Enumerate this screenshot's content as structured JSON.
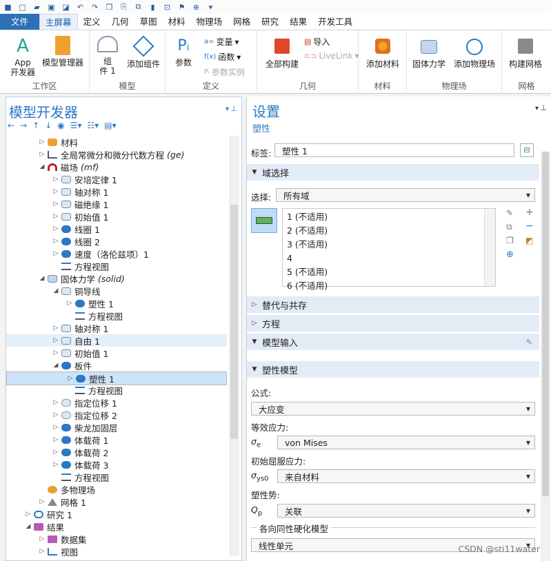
{
  "ribbon": {
    "tabs": [
      "文件",
      "主屏幕",
      "定义",
      "几何",
      "草图",
      "材料",
      "物理场",
      "网格",
      "研究",
      "结果",
      "开发工具"
    ],
    "app_builder": [
      "App",
      "开发器"
    ],
    "model_manager": "模型管理器",
    "group_workspace": "工作区",
    "component": [
      "组",
      "件 1"
    ],
    "add_component": "添加组件",
    "group_model": "模型",
    "params": "参数",
    "variables": "变量",
    "functions": "函数",
    "param_instance": "参数实例",
    "group_define": "定义",
    "build_all": "全部构建",
    "import": "导入",
    "livelink": "LiveLink",
    "group_geom": "几何",
    "add_material": "添加材料",
    "group_material": "材料",
    "solid_mech": "固体力学",
    "add_physics": "添加物理场",
    "group_physics": "物理场",
    "build_mesh": "构建网格",
    "group_mesh": "网格"
  },
  "left": {
    "title": "模型开发器",
    "tree": [
      {
        "label": "材料",
        "depth": 2,
        "arrow": "▷",
        "icon": "materials-icon"
      },
      {
        "label": "全局常微分和微分代数方程",
        "tag": "(ge)",
        "depth": 2,
        "arrow": "▷",
        "icon": "ode-icon"
      },
      {
        "label": "磁场",
        "tag": "(mf)",
        "depth": 2,
        "arrow": "◢",
        "icon": "magnet-icon"
      },
      {
        "label": "安培定律 1",
        "depth": 3,
        "arrow": "▷",
        "icon": "node-icon"
      },
      {
        "label": "轴对称 1",
        "depth": 3,
        "arrow": "▷",
        "icon": "node-icon"
      },
      {
        "label": "磁绝缘 1",
        "depth": 3,
        "arrow": "▷",
        "icon": "node-icon"
      },
      {
        "label": "初始值 1",
        "depth": 3,
        "arrow": "▷",
        "icon": "node-icon"
      },
      {
        "label": "线圈 1",
        "depth": 3,
        "arrow": "▷",
        "icon": "pill-icon"
      },
      {
        "label": "线圈 2",
        "depth": 3,
        "arrow": "▷",
        "icon": "pill-icon"
      },
      {
        "label": "速度（洛伦兹项）1",
        "depth": 3,
        "arrow": "▷",
        "icon": "pill-icon"
      },
      {
        "label": "方程视图",
        "depth": 3,
        "arrow": "",
        "icon": "equation-icon"
      },
      {
        "label": "固体力学",
        "tag": "(solid)",
        "depth": 2,
        "arrow": "◢",
        "icon": "solid-icon"
      },
      {
        "label": "铜导线",
        "depth": 3,
        "arrow": "◢",
        "icon": "node-icon"
      },
      {
        "label": "塑性 1",
        "depth": 4,
        "arrow": "▷",
        "icon": "pill-icon"
      },
      {
        "label": "方程视图",
        "depth": 4,
        "arrow": "",
        "icon": "equation-icon"
      },
      {
        "label": "轴对称 1",
        "depth": 3,
        "arrow": "▷",
        "icon": "node-icon"
      },
      {
        "label": "自由 1",
        "depth": 3,
        "arrow": "▷",
        "icon": "node-icon",
        "state": "hl"
      },
      {
        "label": "初始值 1",
        "depth": 3,
        "arrow": "▷",
        "icon": "node-icon"
      },
      {
        "label": "板件",
        "depth": 3,
        "arrow": "◢",
        "icon": "pill-icon"
      },
      {
        "label": "塑性 1",
        "depth": 4,
        "arrow": "▷",
        "icon": "pill-icon",
        "state": "sel"
      },
      {
        "label": "方程视图",
        "depth": 4,
        "arrow": "",
        "icon": "equation-icon"
      },
      {
        "label": "指定位移 1",
        "depth": 3,
        "arrow": "▷",
        "icon": "pillo-icon"
      },
      {
        "label": "指定位移 2",
        "depth": 3,
        "arrow": "▷",
        "icon": "pillo-icon"
      },
      {
        "label": "柴龙加固层",
        "depth": 3,
        "arrow": "▷",
        "icon": "pill-icon"
      },
      {
        "label": "体载荷 1",
        "depth": 3,
        "arrow": "▷",
        "icon": "pill-icon"
      },
      {
        "label": "体载荷 2",
        "depth": 3,
        "arrow": "▷",
        "icon": "pill-icon"
      },
      {
        "label": "体载荷 3",
        "depth": 3,
        "arrow": "▷",
        "icon": "pill-icon"
      },
      {
        "label": "方程视图",
        "depth": 3,
        "arrow": "",
        "icon": "equation-icon"
      },
      {
        "label": "多物理场",
        "depth": 2,
        "arrow": "",
        "icon": "multiphysics-icon"
      },
      {
        "label": "网格 1",
        "depth": 2,
        "arrow": "▷",
        "icon": "mesh-icon"
      },
      {
        "label": "研究 1",
        "depth": 1,
        "arrow": "▷",
        "icon": "study-icon"
      },
      {
        "label": "结果",
        "depth": 1,
        "arrow": "◢",
        "icon": "results-icon"
      },
      {
        "label": "数据集",
        "depth": 2,
        "arrow": "▷",
        "icon": "dataset-icon"
      },
      {
        "label": "视图",
        "depth": 2,
        "arrow": "▷",
        "icon": "view-icon"
      }
    ]
  },
  "right": {
    "title": "设置",
    "subtitle": "塑性",
    "label_caption": "标签:",
    "label_value": "塑性 1",
    "sec_domain": "域选择",
    "select_caption": "选择:",
    "select_value": "所有域",
    "domains": [
      "1 (不适用)",
      "2 (不适用)",
      "3 (不适用)",
      "4",
      "5 (不适用)",
      "6 (不适用)"
    ],
    "sec_override": "替代与共存",
    "sec_equation": "方程",
    "sec_model_input": "模型输入",
    "sec_plastic": "塑性模型",
    "formula_caption": "公式:",
    "formula_value": "大应变",
    "eq_stress_caption": "等效应力:",
    "sigma_e": "σ",
    "sigma_e_sub": "e",
    "eq_stress_value": "von Mises",
    "yield_caption": "初始屈服应力:",
    "sigma_ys": "σ",
    "sigma_ys_sub": "ys0",
    "yield_value": "来自材料",
    "potential_caption": "塑性势:",
    "q_p": "Q",
    "q_p_sub": "p",
    "potential_value": "关联",
    "hardening_caption": "各向同性硬化模型",
    "hardening_value": "线性单元"
  },
  "watermark": "CSDN @sti11water"
}
